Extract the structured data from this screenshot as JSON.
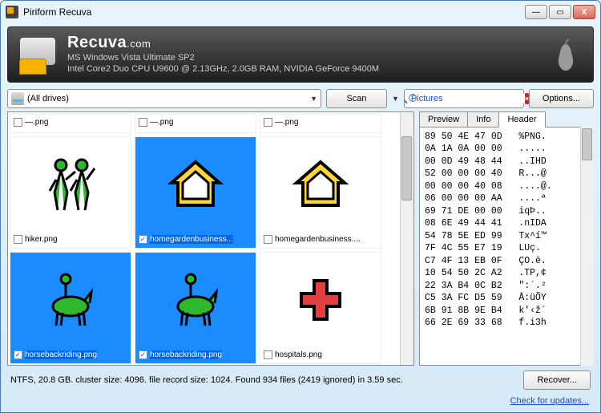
{
  "window": {
    "title": "Piriform Recuva"
  },
  "header": {
    "brand_main": "Recuva",
    "brand_suffix": ".com",
    "line1": "MS Windows Vista Ultimate SP2",
    "line2": "Intel Core2 Duo CPU U9600 @ 2.13GHz, 2.0GB RAM, NVIDIA GeForce 9400M"
  },
  "toolbar": {
    "drive_label": "(All drives)",
    "scan_label": "Scan",
    "search_value": "Pictures",
    "options_label": "Options..."
  },
  "files": {
    "row0": {
      "a": "—.png",
      "b": "—.png",
      "c": "—.png"
    },
    "row1": {
      "a": "hiker.png",
      "b": "homegardenbusiness...",
      "c": "homegardenbusiness...."
    },
    "row2": {
      "a": "horsebackriding.png",
      "b": "horsebackriding.png",
      "c": "hospitals.png"
    }
  },
  "tabs": {
    "preview": "Preview",
    "info": "Info",
    "header": "Header"
  },
  "hex": "89 50 4E 47 0D   %PNG.\n0A 1A 0A 00 00   .....\n00 0D 49 48 44   ..IHD\n52 00 00 00 40   R...@\n00 00 00 40 08   ....@.\n06 00 00 00 AA   ....ª\n69 71 DE 00 00   iqÞ..\n08 6E 49 44 41   .nIDA\n54 78 5E ED 99   Tx^í™\n7F 4C 55 E7 19   LUç.\nC7 4F 13 EB 0F   ÇO.ë.\n10 54 50 2C A2   .TP,¢\n22 3A B4 0C B2   \":´.²\nC5 3A FC D5 59   Å:üÕY\n6B 91 8B 9E B4   k'‹ž´\n66 2E 69 33 68   f.i3h",
  "status": {
    "text": "NTFS, 20.8 GB. cluster size: 4096. file record size: 1024. Found 934 files (2419 ignored) in 3.59 sec.",
    "recover_label": "Recover..."
  },
  "footer": {
    "link": "Check for updates..."
  }
}
